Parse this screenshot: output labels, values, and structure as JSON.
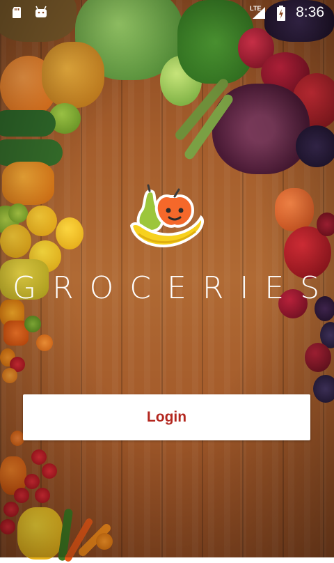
{
  "status_bar": {
    "time": "8:36",
    "network_label": "LTE",
    "icons": [
      "sd-card-icon",
      "android-icon",
      "signal-icon",
      "battery-charging-icon"
    ]
  },
  "app": {
    "brand_name": "GROCERIES",
    "logo_icon": "fruit-logo-icon"
  },
  "login": {
    "label": "Login",
    "text_color": "#b3261e",
    "background": "#ffffff"
  }
}
